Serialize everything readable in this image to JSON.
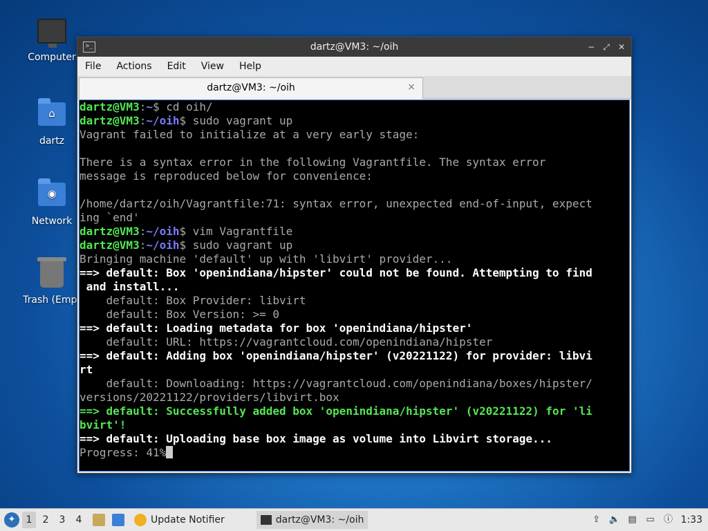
{
  "desktop": {
    "icons": [
      {
        "label": "Computer",
        "icon": "computer-icon"
      },
      {
        "label": "dartz",
        "icon": "home-folder-icon"
      },
      {
        "label": "Network",
        "icon": "network-folder-icon"
      },
      {
        "label": "Trash (Empt",
        "icon": "trash-icon"
      }
    ]
  },
  "window": {
    "title": "dartz@VM3: ~/oih",
    "controls": {
      "minimize": "−",
      "maximize": "⤢",
      "close": "✕"
    },
    "menu": [
      "File",
      "Actions",
      "Edit",
      "View",
      "Help"
    ],
    "tab": {
      "title": "dartz@VM3: ~/oih",
      "close": "×"
    }
  },
  "terminal": {
    "lines": [
      [
        {
          "t": "dartz@VM3",
          "c": "g"
        },
        {
          "t": ":",
          "c": ""
        },
        {
          "t": "~",
          "c": "b"
        },
        {
          "t": "$ cd oih/",
          "c": ""
        }
      ],
      [
        {
          "t": "dartz@VM3",
          "c": "g"
        },
        {
          "t": ":",
          "c": ""
        },
        {
          "t": "~/oih",
          "c": "b"
        },
        {
          "t": "$ sudo vagrant up",
          "c": ""
        }
      ],
      [
        {
          "t": "Vagrant failed to initialize at a very early stage:",
          "c": ""
        }
      ],
      [
        {
          "t": "",
          "c": ""
        }
      ],
      [
        {
          "t": "There is a syntax error in the following Vagrantfile. The syntax error",
          "c": ""
        }
      ],
      [
        {
          "t": "message is reproduced below for convenience:",
          "c": ""
        }
      ],
      [
        {
          "t": "",
          "c": ""
        }
      ],
      [
        {
          "t": "/home/dartz/oih/Vagrantfile:71: syntax error, unexpected end-of-input, expect",
          "c": ""
        }
      ],
      [
        {
          "t": "ing `end'",
          "c": ""
        }
      ],
      [
        {
          "t": "dartz@VM3",
          "c": "g"
        },
        {
          "t": ":",
          "c": ""
        },
        {
          "t": "~/oih",
          "c": "b"
        },
        {
          "t": "$ vim Vagrantfile",
          "c": ""
        }
      ],
      [
        {
          "t": "dartz@VM3",
          "c": "g"
        },
        {
          "t": ":",
          "c": ""
        },
        {
          "t": "~/oih",
          "c": "b"
        },
        {
          "t": "$ sudo vagrant up",
          "c": ""
        }
      ],
      [
        {
          "t": "Bringing machine 'default' up with 'libvirt' provider...",
          "c": ""
        }
      ],
      [
        {
          "t": "==> default: Box 'openindiana/hipster' could not be found. Attempting to find",
          "c": "w"
        }
      ],
      [
        {
          "t": " and install...",
          "c": "w"
        }
      ],
      [
        {
          "t": "    default: Box Provider: libvirt",
          "c": ""
        }
      ],
      [
        {
          "t": "    default: Box Version: >= 0",
          "c": ""
        }
      ],
      [
        {
          "t": "==> default: Loading metadata for box 'openindiana/hipster'",
          "c": "w"
        }
      ],
      [
        {
          "t": "    default: URL: https://vagrantcloud.com/openindiana/hipster",
          "c": ""
        }
      ],
      [
        {
          "t": "==> default: Adding box 'openindiana/hipster' (v20221122) for provider: libvi",
          "c": "w"
        }
      ],
      [
        {
          "t": "rt",
          "c": "w"
        }
      ],
      [
        {
          "t": "    default: Downloading: https://vagrantcloud.com/openindiana/boxes/hipster/",
          "c": ""
        }
      ],
      [
        {
          "t": "versions/20221122/providers/libvirt.box",
          "c": ""
        }
      ],
      [
        {
          "t": "==> default: Successfully added box 'openindiana/hipster' (v20221122) for 'li",
          "c": "gb"
        }
      ],
      [
        {
          "t": "bvirt'!",
          "c": "gb"
        }
      ],
      [
        {
          "t": "==> default: Uploading base box image as volume into Libvirt storage...",
          "c": "w"
        }
      ],
      [
        {
          "t": "Progress: 41%",
          "c": ""
        }
      ]
    ]
  },
  "taskbar": {
    "workspaces": [
      "1",
      "2",
      "3",
      "4"
    ],
    "active_workspace": "1",
    "apps": [
      {
        "label": "Update Notifier",
        "icon": "update-notifier-icon"
      },
      {
        "label": "dartz@VM3: ~/oih",
        "icon": "terminal-icon"
      }
    ],
    "clock": "1:33"
  }
}
